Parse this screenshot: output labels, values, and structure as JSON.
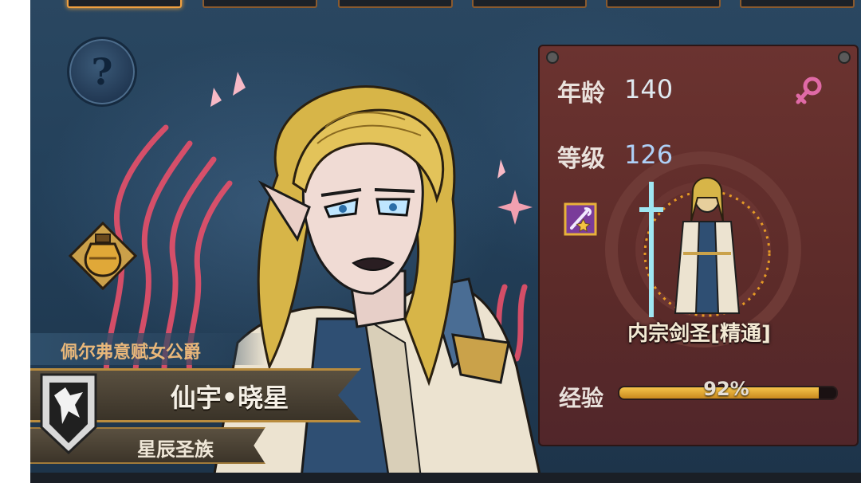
{
  "stats": {
    "age_label": "年龄",
    "age_value": "140",
    "level_label": "等级",
    "level_value": "126",
    "exp_label": "经验",
    "exp_percent_text": "92%",
    "exp_fraction": 0.92
  },
  "character": {
    "title": "佩尔弗意赋女公爵",
    "name": "仙宇•晓星",
    "race": "星辰圣族",
    "class_name": "内宗剑圣[精通]",
    "gender_icon": "female-icon"
  },
  "icons": {
    "help": "question-mark-icon",
    "potion": "potion-icon",
    "skill": "sword-skill-icon",
    "faction": "wolf-shield-icon"
  },
  "help_glyph": "?",
  "colors": {
    "panel": "#5c2b29",
    "exp_fill": "#e8ac33",
    "level_value": "#aed0f7",
    "female_icon": "#e06aa6"
  }
}
